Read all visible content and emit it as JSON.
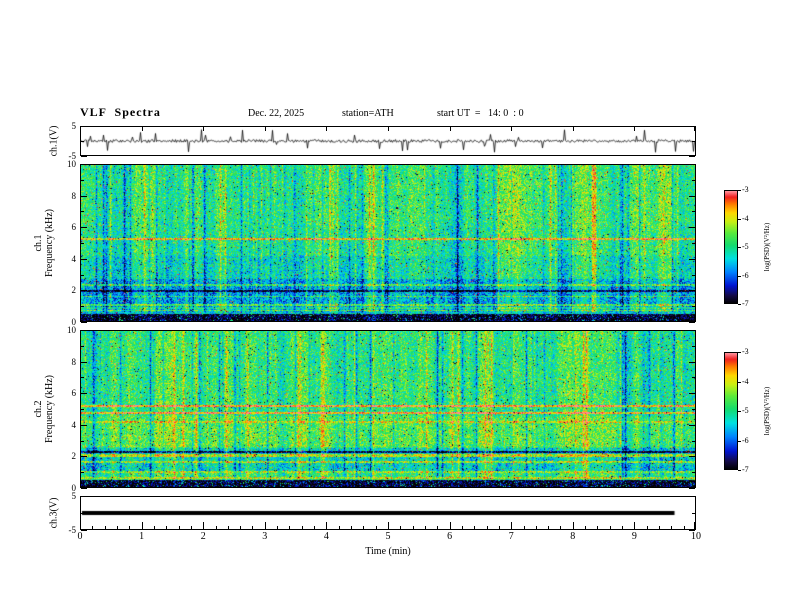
{
  "header": {
    "title": "VLF  Spectra",
    "date": "Dec. 22, 2025",
    "station": "station=ATH",
    "start_ut": "start UT  =   14: 0  : 0"
  },
  "xaxis": {
    "label": "Time (min)",
    "ticks": [
      0,
      1,
      2,
      3,
      4,
      5,
      6,
      7,
      8,
      9,
      10
    ],
    "minor_step": 0.2,
    "range": [
      0,
      10
    ]
  },
  "colorbar": {
    "label": "log(PSD)(V²/Hz)",
    "ticks": [
      -3,
      -4,
      -5,
      -6,
      -7
    ],
    "range": [
      -7,
      -3
    ],
    "colors_top_to_bottom": [
      "#ff8c96",
      "#f01e1e",
      "#ff7800",
      "#ffd700",
      "#c8f014",
      "#14dc6e",
      "#00e1e1",
      "#0082ff",
      "#0014d2",
      "#140a46",
      "#000000"
    ]
  },
  "chart_data": [
    {
      "name": "ch1-waveform",
      "type": "line",
      "ylabel": "ch.1(V)",
      "ylim": [
        -5,
        5
      ],
      "yticks": [
        5,
        -5
      ],
      "xlim": [
        0,
        10
      ],
      "signal": {
        "description": "broadband noise ~±0.6 V with frequent impulsive spikes reaching ±4.5 V across the full 10 min record",
        "seed": 5,
        "noise_amp": 0.55,
        "spike_prob": 0.055,
        "spike_amp": 3.2
      }
    },
    {
      "name": "ch1-spectrogram",
      "type": "heatmap",
      "ylabel_line1": "ch.1",
      "ylabel_line2": "Frequency (kHz)",
      "ylim": [
        0,
        10
      ],
      "yticks": [
        0,
        2,
        4,
        6,
        8,
        10
      ],
      "xlim": [
        0,
        10
      ],
      "value_range": [
        -7,
        -3
      ],
      "features": {
        "seed": 11,
        "base_level": 0.52,
        "noise": 0.18,
        "bands": [
          {
            "f_lo": 0.0,
            "f_hi": 0.45,
            "delta": -0.5
          },
          {
            "f_lo": 0.45,
            "f_hi": 0.8,
            "delta": -0.12
          },
          {
            "f_lo": 0.9,
            "f_hi": 2.7,
            "delta": -0.16
          },
          {
            "f_lo": 2.7,
            "f_hi": 4.2,
            "delta": -0.05
          },
          {
            "f_lo": 6.0,
            "f_hi": 10.0,
            "delta": 0.02
          }
        ],
        "lines": [
          {
            "f": 5.3,
            "delta": 0.34,
            "width": 0.06
          },
          {
            "f": 2.35,
            "delta": 0.22,
            "width": 0.05
          },
          {
            "f": 1.95,
            "delta": -0.3,
            "width": 0.08
          },
          {
            "f": 1.6,
            "delta": 0.2,
            "width": 0.05
          },
          {
            "f": 1.05,
            "delta": 0.26,
            "width": 0.06
          },
          {
            "f": 0.7,
            "delta": 0.22,
            "width": 0.05
          }
        ],
        "streaks": {
          "bright_prob": 0.05,
          "dark_prob": 0.045
        }
      }
    },
    {
      "name": "ch2-spectrogram",
      "type": "heatmap",
      "ylabel_line1": "ch.2",
      "ylabel_line2": "Frequency (kHz)",
      "ylim": [
        0,
        10
      ],
      "yticks": [
        0,
        2,
        4,
        6,
        8,
        10
      ],
      "xlim": [
        0,
        10
      ],
      "value_range": [
        -7,
        -3
      ],
      "features": {
        "seed": 29,
        "base_level": 0.53,
        "noise": 0.18,
        "bands": [
          {
            "f_lo": 0.0,
            "f_hi": 0.45,
            "delta": -0.5
          },
          {
            "f_lo": 0.9,
            "f_hi": 2.5,
            "delta": -0.1
          },
          {
            "f_lo": 2.6,
            "f_hi": 4.6,
            "delta": 0.06
          }
        ],
        "lines": [
          {
            "f": 5.25,
            "delta": 0.38,
            "width": 0.06
          },
          {
            "f": 4.75,
            "delta": 0.36,
            "width": 0.06
          },
          {
            "f": 4.2,
            "delta": 0.16,
            "width": 0.05
          },
          {
            "f": 2.3,
            "delta": -0.35,
            "width": 0.06
          },
          {
            "f": 2.05,
            "delta": 0.3,
            "width": 0.07
          },
          {
            "f": 1.65,
            "delta": 0.25,
            "width": 0.05
          },
          {
            "f": 1.0,
            "delta": 0.25,
            "width": 0.06
          },
          {
            "f": 0.6,
            "delta": 0.2,
            "width": 0.05
          }
        ],
        "streaks": {
          "bright_prob": 0.05,
          "dark_prob": 0.06
        }
      }
    },
    {
      "name": "ch3-waveform",
      "type": "line",
      "ylabel": "ch.3(V)",
      "ylim": [
        -5,
        5
      ],
      "yticks": [
        5,
        -5
      ],
      "xlim": [
        0,
        10
      ],
      "signal": {
        "description": "flat thick line at 0 V (no signal), ending near 9.7 min",
        "value": 0,
        "end_frac": 0.965
      }
    }
  ]
}
